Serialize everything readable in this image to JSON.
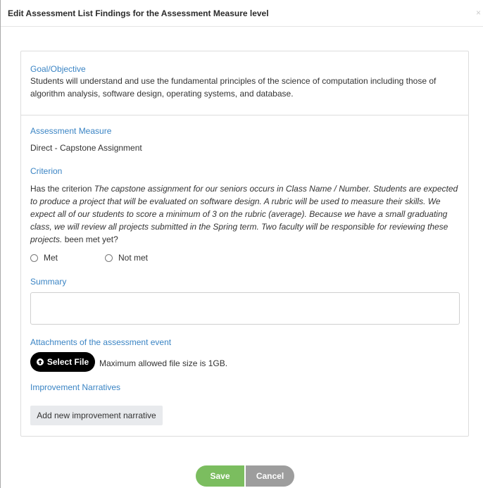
{
  "modal": {
    "title": "Edit Assessment List Findings for the Assessment Measure level",
    "close_symbol": "×"
  },
  "goal": {
    "label": "Goal/Objective",
    "text": "Students will understand and use the fundamental principles of the science of computation including those of algorithm analysis, software design, operating systems, and database."
  },
  "measure": {
    "label": "Assessment Measure",
    "value": "Direct - Capstone Assignment"
  },
  "criterion": {
    "label": "Criterion",
    "prefix": "Has the criterion ",
    "italic_text": "The capstone assignment for our seniors occurs in Class Name / Number. Students are expected to produce a project that will be evaluated on software design. A rubric will be used to measure their skills. We expect all of our students to score a minimum of 3 on the rubric (average). Because we have a small graduating class, we will review all projects submitted in the Spring term. Two faculty will be responsible for reviewing these projects.",
    "suffix": " been met yet?",
    "options": [
      "Met",
      "Not met"
    ]
  },
  "summary": {
    "label": "Summary",
    "value": ""
  },
  "attachments": {
    "label": "Attachments of the assessment event",
    "select_button": "Select File",
    "note": "Maximum allowed file size is 1GB."
  },
  "narratives": {
    "label": "Improvement Narratives",
    "add_button": "Add new improvement narrative"
  },
  "footer": {
    "save_label": "Save",
    "cancel_label": "Cancel"
  },
  "colors": {
    "accent": "#3a84c4",
    "save": "#7bbd5f",
    "cancel": "#9d9d9d"
  },
  "icons": {
    "upload": "circle-arrow-up-icon",
    "close": "close-icon"
  }
}
